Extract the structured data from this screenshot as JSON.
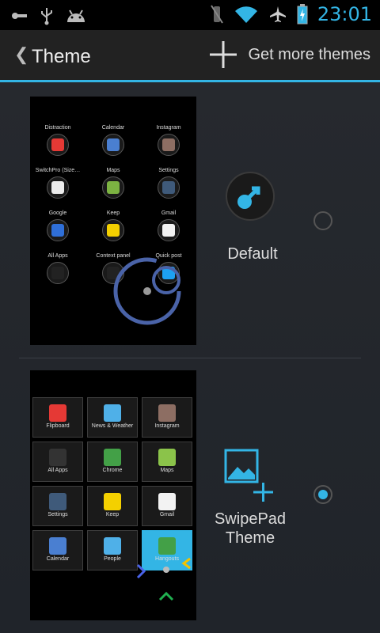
{
  "status_bar": {
    "icons": [
      "usb-debug-icon",
      "usb-icon",
      "android-icon",
      "mute-icon",
      "wifi-icon",
      "airplane-icon",
      "battery-charging-icon"
    ],
    "time": "23:01"
  },
  "action_bar": {
    "back_glyph": "❮",
    "title": "Theme",
    "action_label": "Get more themes"
  },
  "themes": [
    {
      "name": "Default",
      "selected": false,
      "preview_apps": [
        {
          "label": "Distraction",
          "color": "#e53935"
        },
        {
          "label": "Calendar",
          "color": "#4a7fd1"
        },
        {
          "label": "Instagram",
          "color": "#8d6e63"
        },
        {
          "label": "SwitchPro (Size…",
          "color": "#ececec"
        },
        {
          "label": "Maps",
          "color": "#7cb342"
        },
        {
          "label": "Settings",
          "color": "#3f5a7a"
        },
        {
          "label": "Google",
          "color": "#2f6fd8"
        },
        {
          "label": "Keep",
          "color": "#f4d000"
        },
        {
          "label": "Gmail",
          "color": "#f2f2f2"
        },
        {
          "label": "All Apps",
          "color": "#222222"
        },
        {
          "label": "Context panel",
          "color": "#222222"
        },
        {
          "label": "Quick post",
          "color": "#1da1f2"
        }
      ]
    },
    {
      "name": "SwipePad Theme",
      "selected": true,
      "preview_apps": [
        {
          "label": "Flipboard",
          "color": "#e53935"
        },
        {
          "label": "News & Weather",
          "color": "#4fb0e8"
        },
        {
          "label": "Instagram",
          "color": "#8d6e63"
        },
        {
          "label": "All Apps",
          "color": "#333333"
        },
        {
          "label": "Chrome",
          "color": "#43a047"
        },
        {
          "label": "Maps",
          "color": "#8bc34a"
        },
        {
          "label": "Settings",
          "color": "#3f5a7a"
        },
        {
          "label": "Keep",
          "color": "#f4d000"
        },
        {
          "label": "Gmail",
          "color": "#f2f2f2"
        },
        {
          "label": "Calendar",
          "color": "#4a7fd1"
        },
        {
          "label": "People",
          "color": "#4fb0e8"
        },
        {
          "label": "Hangouts",
          "color": "#43a047"
        }
      ]
    }
  ],
  "colors": {
    "accent": "#33b5e5"
  }
}
